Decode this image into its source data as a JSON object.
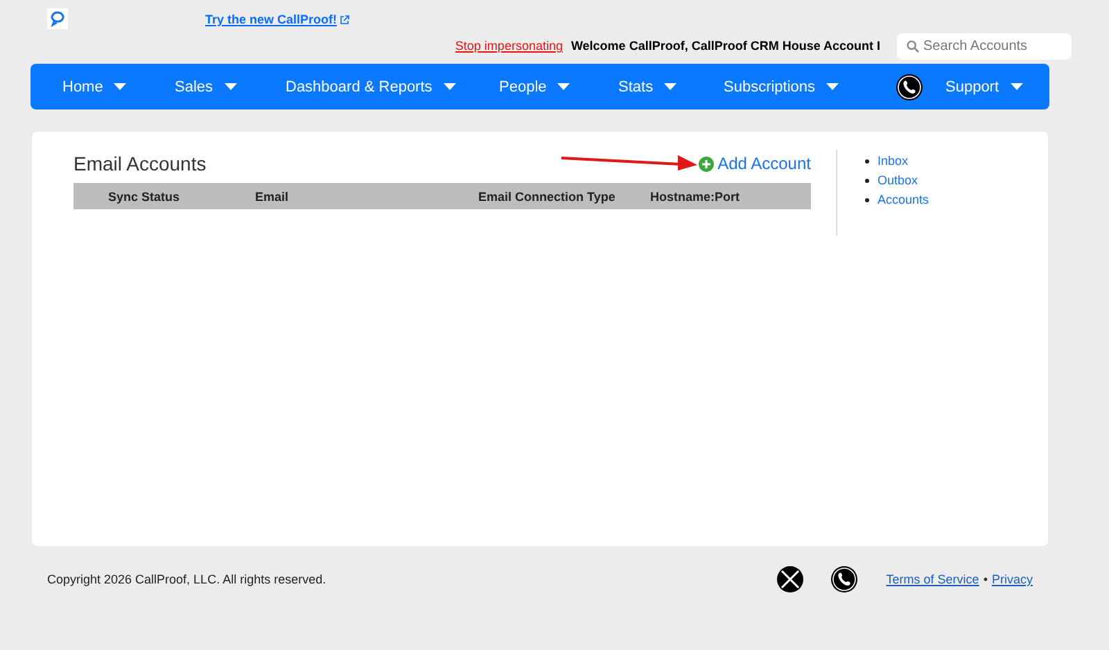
{
  "header": {
    "promo_link": "Try the new CallProof!",
    "stop_link": "Stop impersonating",
    "welcome": "Welcome CallProof, CallProof CRM House Account I",
    "search": {
      "placeholder": "Search Accounts"
    }
  },
  "nav": [
    {
      "label": "Home",
      "kind": "menu"
    },
    {
      "label": "Sales",
      "kind": "menu"
    },
    {
      "label": "Dashboard & Reports",
      "kind": "menu"
    },
    {
      "label": "People",
      "kind": "menu"
    },
    {
      "label": "Stats",
      "kind": "menu"
    },
    {
      "label": "Subscriptions",
      "kind": "menu"
    },
    {
      "kind": "phone"
    },
    {
      "label": "Support",
      "kind": "menu"
    }
  ],
  "content": {
    "title": "Email Accounts",
    "add_button": "Add Account",
    "table": {
      "columns": [
        "Sync Status",
        "Email",
        "Email Connection Type",
        "Hostname:Port"
      ]
    }
  },
  "sidebar": {
    "items": [
      "Inbox",
      "Outbox",
      "Accounts"
    ]
  },
  "footer": {
    "copyright": "Copyright 2026 CallProof, LLC. All rights reserved.",
    "links": [
      "Terms of Service",
      "Privacy"
    ],
    "separator": "•"
  }
}
